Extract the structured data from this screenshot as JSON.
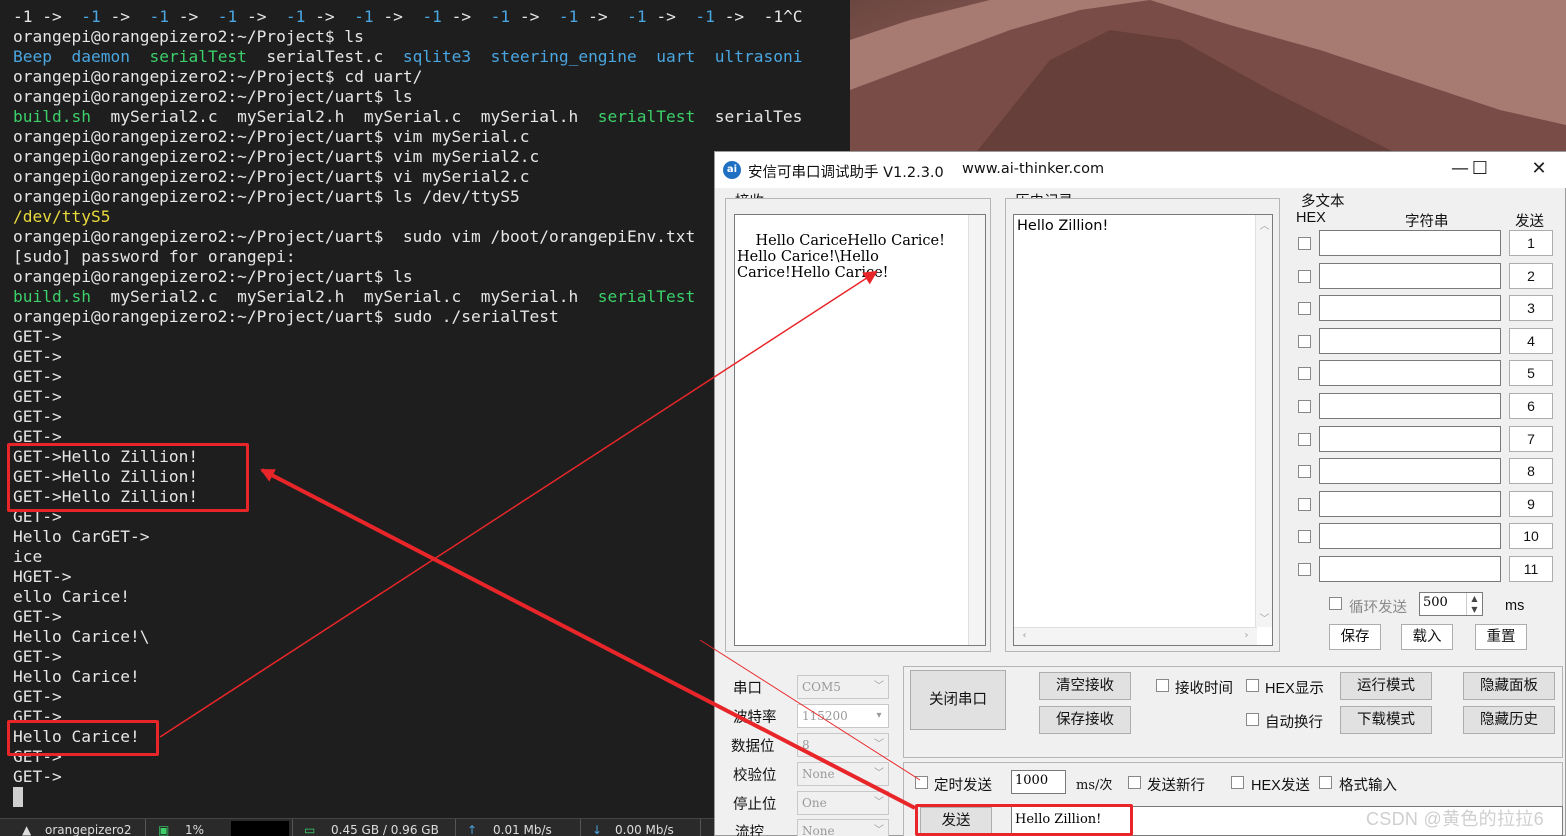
{
  "terminal": {
    "lines": [
      [
        {
          "t": "-1 -> "
        },
        {
          "t": " -1",
          "c": "c-blue"
        },
        {
          "t": " -> "
        },
        {
          "t": " -1",
          "c": "c-blue"
        },
        {
          "t": " -> "
        },
        {
          "t": " -1",
          "c": "c-blue"
        },
        {
          "t": " -> "
        },
        {
          "t": " -1",
          "c": "c-blue"
        },
        {
          "t": " -> "
        },
        {
          "t": " -1",
          "c": "c-blue"
        },
        {
          "t": " -> "
        },
        {
          "t": " -1",
          "c": "c-blue"
        },
        {
          "t": " -> "
        },
        {
          "t": " -1",
          "c": "c-blue"
        },
        {
          "t": " -> "
        },
        {
          "t": " -1",
          "c": "c-blue"
        },
        {
          "t": " -> "
        },
        {
          "t": " -1",
          "c": "c-blue"
        },
        {
          "t": " -> "
        },
        {
          "t": " -1",
          "c": "c-blue"
        },
        {
          "t": " ->  -1^C"
        }
      ],
      [
        {
          "t": "orangepi@orangepizero2:~/Project$ ls"
        }
      ],
      [
        {
          "t": "Beep",
          "c": "c-blue"
        },
        {
          "t": "  "
        },
        {
          "t": "daemon",
          "c": "c-blue"
        },
        {
          "t": "  "
        },
        {
          "t": "serialTest",
          "c": "c-green"
        },
        {
          "t": "  serialTest.c  "
        },
        {
          "t": "sqlite3",
          "c": "c-blue"
        },
        {
          "t": "  "
        },
        {
          "t": "steering_engine",
          "c": "c-blue"
        },
        {
          "t": "  "
        },
        {
          "t": "uart",
          "c": "c-blue"
        },
        {
          "t": "  "
        },
        {
          "t": "ultrasoni",
          "c": "c-blue"
        }
      ],
      [
        {
          "t": "orangepi@orangepizero2:~/Project$ cd uart/"
        }
      ],
      [
        {
          "t": "orangepi@orangepizero2:~/Project/uart$ ls"
        }
      ],
      [
        {
          "t": "build.sh",
          "c": "c-green"
        },
        {
          "t": "  mySerial2.c  mySerial2.h  mySerial.c  mySerial.h  "
        },
        {
          "t": "serialTest",
          "c": "c-green"
        },
        {
          "t": "  serialTes"
        }
      ],
      [
        {
          "t": "orangepi@orangepizero2:~/Project/uart$ vim mySerial.c"
        }
      ],
      [
        {
          "t": "orangepi@orangepizero2:~/Project/uart$ vim mySerial2.c"
        }
      ],
      [
        {
          "t": "orangepi@orangepizero2:~/Project/uart$ vi mySerial2.c"
        }
      ],
      [
        {
          "t": "orangepi@orangepizero2:~/Project/uart$ ls /dev/ttyS5"
        }
      ],
      [
        {
          "t": "/dev/ttyS5",
          "c": "c-yellow"
        }
      ],
      [
        {
          "t": "orangepi@orangepizero2:~/Project/uart$  sudo vim /boot/orangepiEnv.txt"
        }
      ],
      [
        {
          "t": "[sudo] password for orangepi:"
        }
      ],
      [
        {
          "t": "orangepi@orangepizero2:~/Project/uart$ ls"
        }
      ],
      [
        {
          "t": "build.sh",
          "c": "c-green"
        },
        {
          "t": "  mySerial2.c  mySerial2.h  mySerial.c  mySerial.h  "
        },
        {
          "t": "serialTest",
          "c": "c-green"
        }
      ],
      [
        {
          "t": "orangepi@orangepizero2:~/Project/uart$ sudo ./serialTest"
        }
      ],
      [
        {
          "t": "GET->"
        }
      ],
      [
        {
          "t": "GET->"
        }
      ],
      [
        {
          "t": "GET->"
        }
      ],
      [
        {
          "t": "GET->"
        }
      ],
      [
        {
          "t": "GET->"
        }
      ],
      [
        {
          "t": "GET->"
        }
      ],
      [
        {
          "t": "GET->Hello Zillion!"
        }
      ],
      [
        {
          "t": "GET->Hello Zillion!"
        }
      ],
      [
        {
          "t": "GET->Hello Zillion!"
        }
      ],
      [
        {
          "t": "GET->"
        }
      ],
      [
        {
          "t": "Hello CarGET->"
        }
      ],
      [
        {
          "t": "ice"
        }
      ],
      [
        {
          "t": "HGET->"
        }
      ],
      [
        {
          "t": "ello Carice!"
        }
      ],
      [
        {
          "t": "GET->"
        }
      ],
      [
        {
          "t": "Hello Carice!\\"
        }
      ],
      [
        {
          "t": "GET->"
        }
      ],
      [
        {
          "t": "Hello Carice!"
        }
      ],
      [
        {
          "t": "GET->"
        }
      ],
      [
        {
          "t": "GET->"
        }
      ],
      [
        {
          "t": "Hello Carice!"
        }
      ],
      [
        {
          "t": "GET->"
        }
      ],
      [
        {
          "t": "GET->"
        }
      ]
    ],
    "statusbar": {
      "host": "orangepizero2",
      "cpu": "1%",
      "mem": "0.45 GB / 0.96 GB",
      "up": "0.01 Mb/s",
      "down": "0.00 Mb/s"
    }
  },
  "serial_window": {
    "title": "安信可串口调试助手 V1.2.3.0",
    "url": "www.ai-thinker.com",
    "icon_text": "ai",
    "controls": {
      "minimize": "—",
      "maximize": "☐",
      "close": "✕"
    },
    "receive": {
      "label": "接收",
      "text": "Hello CariceHello Carice!\nHello Carice!\\Hello\nCarice!Hello Carice!"
    },
    "history": {
      "label": "历史记录",
      "text": "Hello Zillion!"
    },
    "multitext": {
      "label": "多文本",
      "col_hex": "HEX",
      "col_string": "字符串",
      "col_send": "发送",
      "rows": [
        "1",
        "2",
        "3",
        "4",
        "5",
        "6",
        "7",
        "8",
        "9",
        "10",
        "11"
      ],
      "loop_label": "循环发送",
      "loop_value": "500",
      "loop_unit": "ms",
      "save": "保存",
      "load": "载入",
      "reset": "重置"
    },
    "port": {
      "port_label": "串口",
      "port_value": "COM5",
      "baud_label": "波特率",
      "baud_value": "115200",
      "data_label": "数据位",
      "data_value": "8",
      "parity_label": "校验位",
      "parity_value": "None",
      "stop_label": "停止位",
      "stop_value": "One",
      "flow_label": "流控",
      "flow_value": "None"
    },
    "actions": {
      "close_port": "关闭串口",
      "clear_receive": "清空接收",
      "save_receive": "保存接收",
      "recv_time": "接收时间",
      "hex_display": "HEX显示",
      "auto_wrap": "自动换行",
      "run_mode": "运行模式",
      "download_mode": "下载模式",
      "hide_panel": "隐藏面板",
      "hide_history": "隐藏历史"
    },
    "send": {
      "timed_send": "定时发送",
      "interval": "1000",
      "interval_unit": "ms/次",
      "send_newline": "发送新行",
      "hex_send": "HEX发送",
      "format_input": "格式输入",
      "send_button": "发送",
      "send_text": "Hello Zillion!"
    }
  },
  "watermark": "CSDN @黄色的拉拉6",
  "colors": {
    "annotation": "#e8262a",
    "term_blue": "#4aa6e0",
    "term_green": "#3ccf6a",
    "term_yellow": "#e9d93d"
  }
}
